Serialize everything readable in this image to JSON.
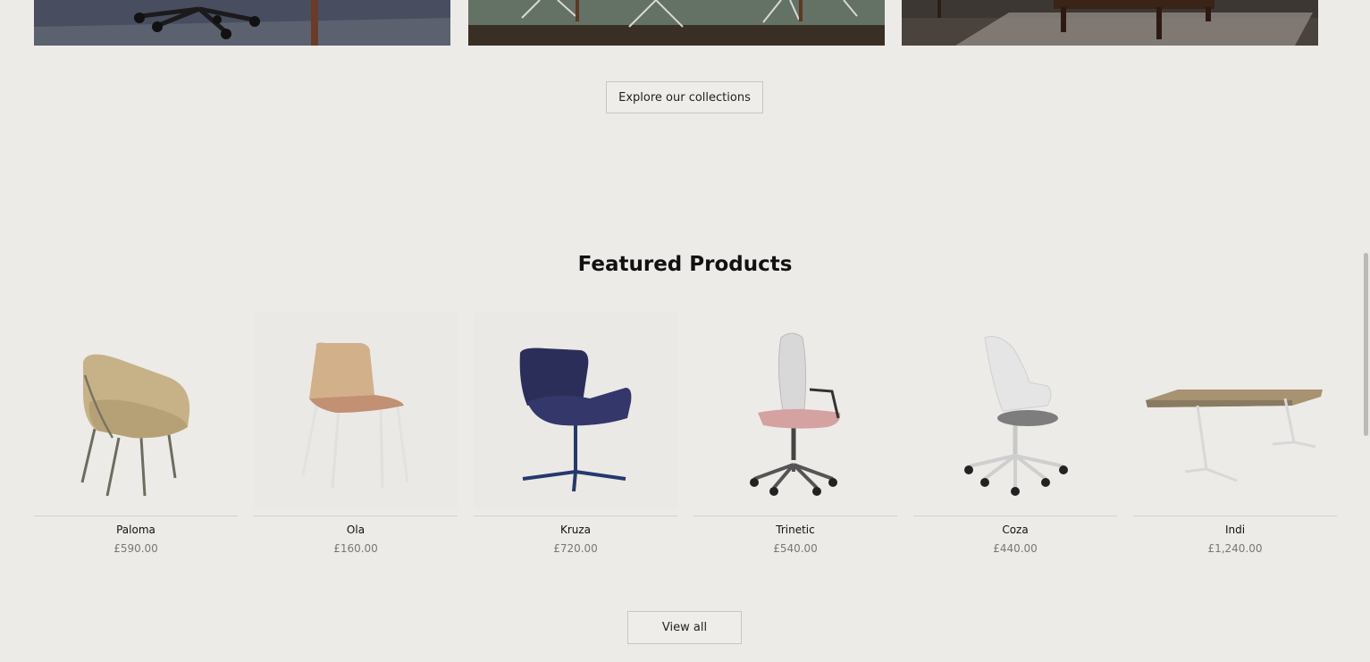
{
  "collections": {
    "tiles": [
      {
        "name": "office-seating-collection",
        "icon": "swivel-chair-base-photo"
      },
      {
        "name": "dining-collection",
        "icon": "table-legs-photo"
      },
      {
        "name": "lounge-collection",
        "icon": "coffee-table-photo"
      }
    ],
    "explore_label": "Explore our collections"
  },
  "featured": {
    "title": "Featured Products",
    "products": [
      {
        "name": "Paloma",
        "price": "£590.00",
        "icon": "lounge-chair-icon"
      },
      {
        "name": "Ola",
        "price": "£160.00",
        "icon": "wooden-shell-chair-icon"
      },
      {
        "name": "Kruza",
        "price": "£720.00",
        "icon": "swivel-armchair-icon"
      },
      {
        "name": "Trinetic",
        "price": "£540.00",
        "icon": "mesh-task-chair-icon"
      },
      {
        "name": "Coza",
        "price": "£440.00",
        "icon": "white-task-chair-icon"
      },
      {
        "name": "Indi",
        "price": "£1,240.00",
        "icon": "bench-desk-icon"
      }
    ],
    "view_all_label": "View all"
  },
  "colors": {
    "background": "#edebe8",
    "button_border": "#c9c6c1",
    "price_text": "#777777"
  }
}
